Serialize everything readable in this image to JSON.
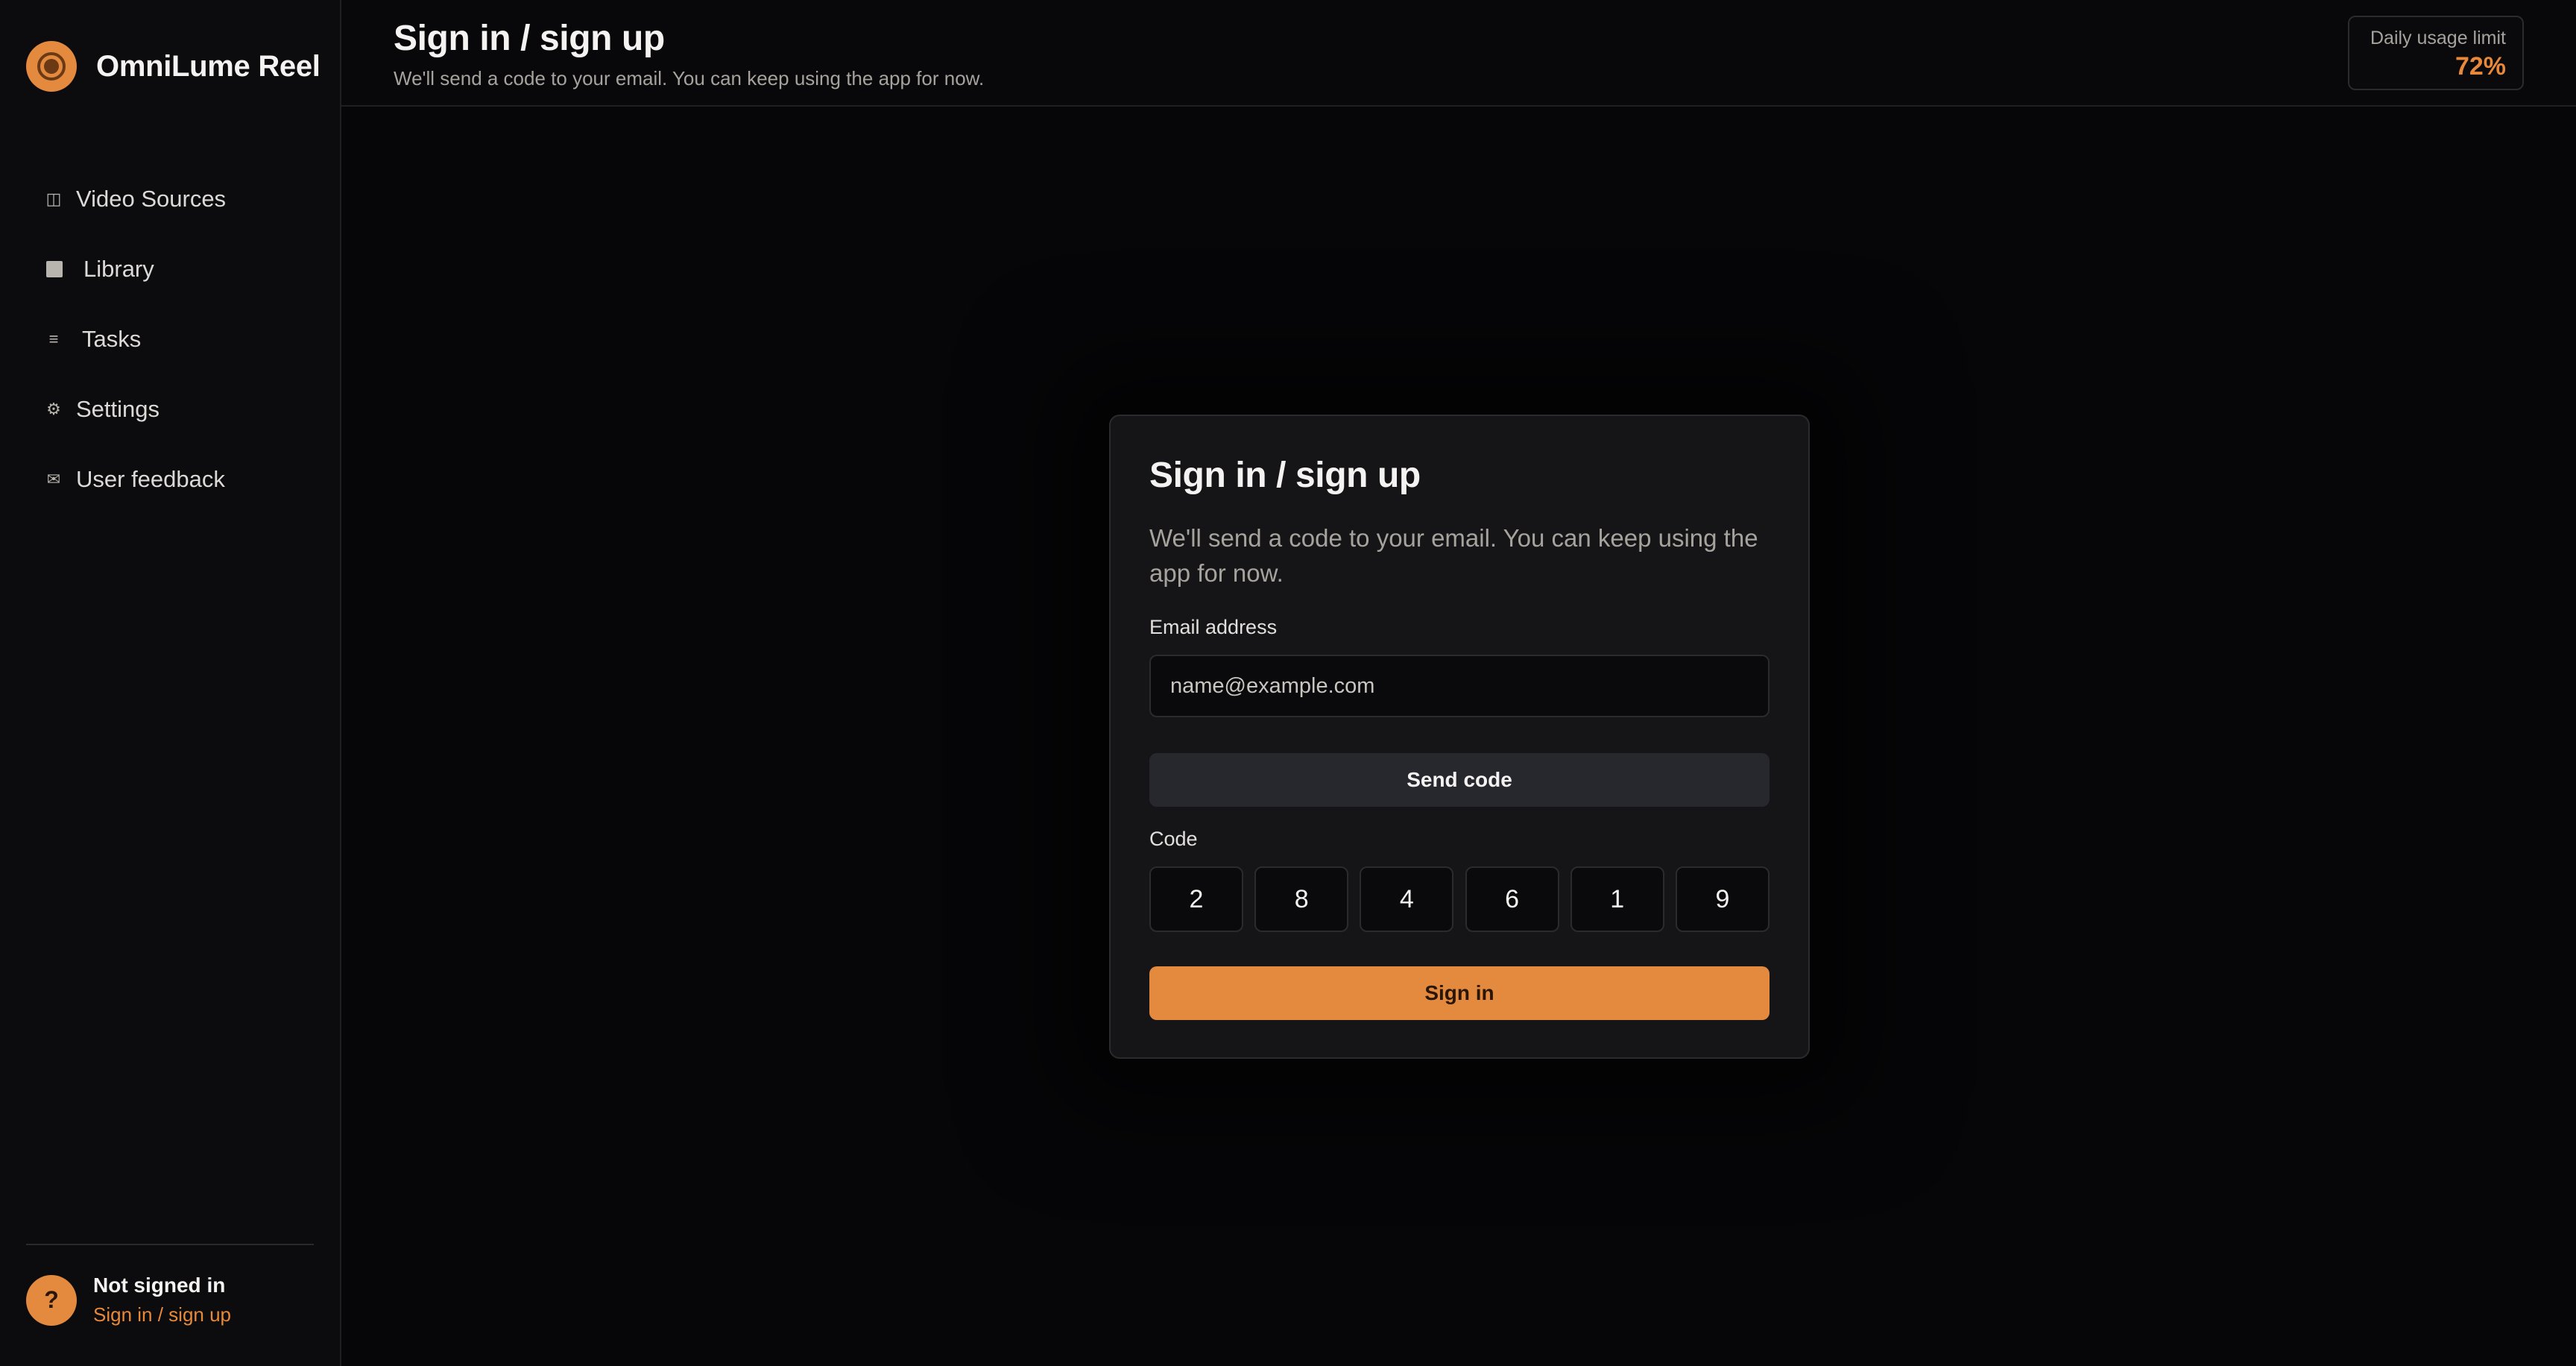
{
  "app": {
    "name": "OmniLume Reel",
    "accent_color": "#e38a3e",
    "logo_icon": "film-reel-icon"
  },
  "sidebar": {
    "items": [
      {
        "label": "Video Sources",
        "icon": "panel-icon"
      },
      {
        "label": "Library",
        "icon": "square-icon"
      },
      {
        "label": "Tasks",
        "icon": "list-icon"
      },
      {
        "label": "Settings",
        "icon": "gear-icon"
      },
      {
        "label": "User feedback",
        "icon": "mail-icon"
      }
    ],
    "user": {
      "avatar_glyph": "?",
      "status": "Not signed in",
      "link": "Sign in / sign up"
    }
  },
  "header": {
    "title": "Sign in / sign up",
    "subtitle": "We'll send a code to your email. You can keep using the app for now.",
    "usage": {
      "label": "Daily usage limit",
      "value": "72%"
    }
  },
  "card": {
    "title": "Sign in / sign up",
    "description": "We'll send a code to your email. You can keep using the app for now.",
    "email_label": "Email address",
    "email_placeholder": "name@example.com",
    "send_code_label": "Send code",
    "code_label": "Code",
    "code_digits": [
      "2",
      "8",
      "4",
      "6",
      "1",
      "9"
    ],
    "sign_in_label": "Sign in"
  }
}
